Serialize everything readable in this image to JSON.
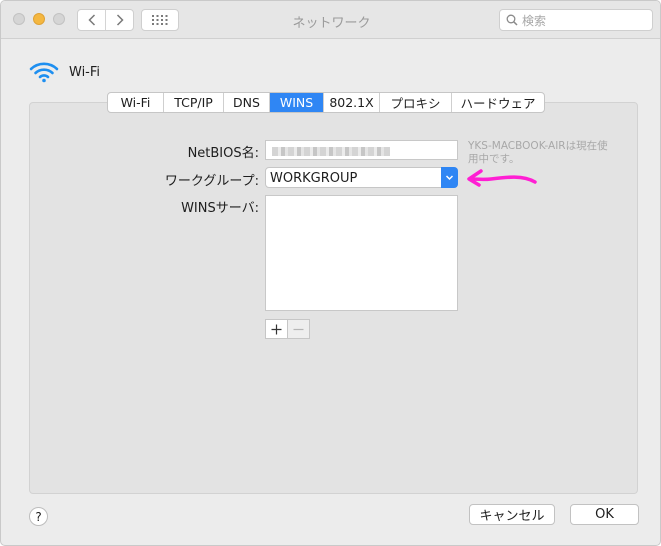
{
  "window": {
    "title": "ネットワーク"
  },
  "search": {
    "placeholder": "検索"
  },
  "interface": {
    "name": "Wi-Fi"
  },
  "tabs": [
    {
      "label": "Wi-Fi",
      "active": false
    },
    {
      "label": "TCP/IP",
      "active": false
    },
    {
      "label": "DNS",
      "active": false
    },
    {
      "label": "WINS",
      "active": true
    },
    {
      "label": "802.1X",
      "active": false
    },
    {
      "label": "プロキシ",
      "active": false
    },
    {
      "label": "ハードウェア",
      "active": false
    }
  ],
  "form": {
    "netbios_label": "NetBIOS名:",
    "netbios_hint": "YKS-MACBOOK-AIRは現在使用中です。",
    "workgroup_label": "ワークグループ:",
    "workgroup_value": "WORKGROUP",
    "wins_label": "WINSサーバ:",
    "add_symbol": "+",
    "remove_symbol": "−"
  },
  "buttons": {
    "help": "?",
    "cancel": "キャンセル",
    "ok": "OK"
  },
  "colors": {
    "accent": "#2f86f4",
    "annotation": "#ff1fd3"
  },
  "icons": [
    "back-icon",
    "forward-icon",
    "grid-icon",
    "search-icon",
    "wifi-icon",
    "chevron-updown-icon",
    "arrow-annotation-icon"
  ]
}
